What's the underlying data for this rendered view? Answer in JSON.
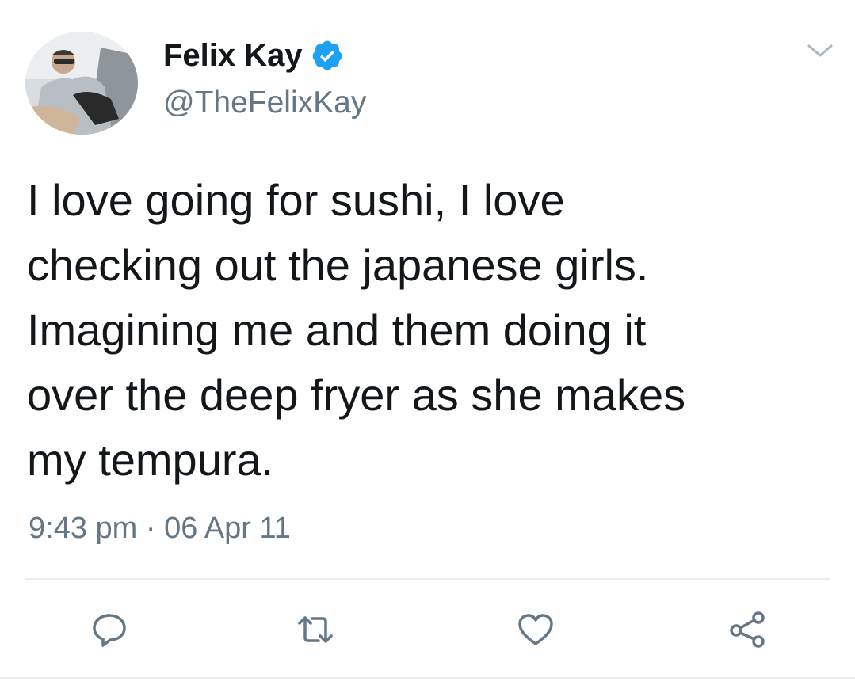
{
  "tweet": {
    "author": {
      "display_name": "Felix Kay",
      "handle": "@TheFelixKay",
      "verified": true,
      "avatar_icon": "profile-photo"
    },
    "text": "I love going for sushi, I love\nchecking out the japanese girls.\nImagining me and them doing it\nover the deep fryer as she makes\nmy tempura.",
    "timestamp": "9:43 pm · 06 Apr 11"
  },
  "actions": [
    {
      "name": "reply",
      "icon": "reply-icon"
    },
    {
      "name": "retweet",
      "icon": "retweet-icon"
    },
    {
      "name": "like",
      "icon": "heart-icon"
    },
    {
      "name": "share",
      "icon": "share-icon"
    }
  ],
  "colors": {
    "text": "#14171a",
    "secondary": "#657786",
    "verified_blue": "#1da1f2",
    "divider": "#e6ecf0",
    "icon": "#657786"
  }
}
